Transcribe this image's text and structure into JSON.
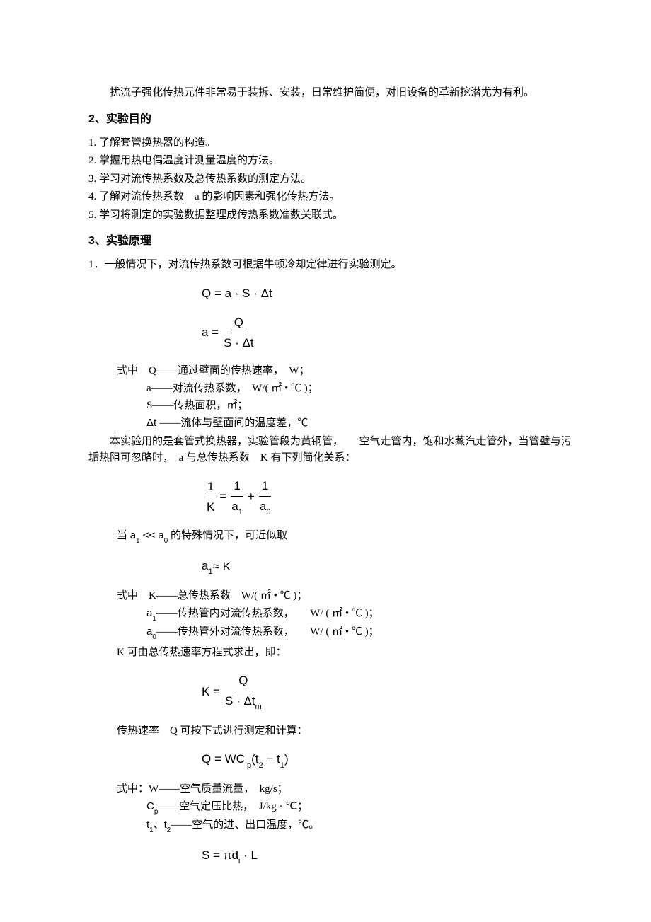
{
  "intro": "扰流子强化传热元件非常易于装拆、安装，日常维护简便，对旧设备的革新挖潜尤为有利。",
  "section2": {
    "heading_num": "2",
    "heading_text": "、实验目的",
    "items": [
      "1. 了解套管换热器的构造。",
      "2. 掌握用热电偶温度计测量温度的方法。",
      "3. 学习对流传热系数及总传热系数的测定方法。",
      "4. 了解对流传热系数　a 的影响因素和强化传热方法。",
      "5. 学习将测定的实验数据整理成传热系数准数关联式。"
    ]
  },
  "section3": {
    "heading_num": "3",
    "heading_text": "、实验原理",
    "p1": "1．一般情况下，对流传热系数可根据牛顿冷却定律进行实验测定。",
    "f1": "Q = a · S · Δt",
    "f2_lhs": "a =",
    "f2_top": "Q",
    "f2_bot": "S · Δt",
    "where_lead": "式中　Q——通过壁面的传热速率，　W；",
    "where_a": "a——对流传热系数，　W/( ㎡ • ℃ )；",
    "where_s": "S——传热面积，㎡；",
    "where_dt": "Δt ——流体与壁面间的温度差，℃",
    "p2a": "本实验用的是套管式换热器，实验管段为黄铜管，　　空气走管内，饱和水蒸汽走管外，当管壁与污垢热阻可忽略时，　a 与总传热系数　K 有下列简化关系：",
    "f3_l_top": "1",
    "f3_l_bot": "K",
    "f3_mid": " = ",
    "f3_r1_top": "1",
    "f3_r1_bot": "a",
    "f3_r1_sub": "1",
    "f3_plus": " + ",
    "f3_r2_top": "1",
    "f3_r2_bot": "a",
    "f3_r2_sub": "0",
    "p3_pre": "当 ",
    "p3_a1": "a",
    "p3_sub1": "1",
    "p3_ll": " << ",
    "p3_a0": "a",
    "p3_sub0": "0",
    "p3_post": " 的特殊情况下，可近似取",
    "f4_lhs": "a",
    "f4_sub": "1",
    "f4_approx": " ≈ K",
    "where_K": "式中　K——总传热系数　W/( ㎡ • ℃ )；",
    "where_a1_pre": "a",
    "where_a1_sub": "1",
    "where_a1_post": "——传热管内对流传热系数，　　W/ ( ㎡ • ℃ )；",
    "where_a0_pre": "a",
    "where_a0_sub": "0",
    "where_a0_post": "——传热管外对流传热系数，　　W/ ( ㎡ • ℃ )；",
    "p4": "K 可由总传热速率方程式求出，即：",
    "f5_lhs": "K =",
    "f5_top": "Q",
    "f5_bot_pre": "S · Δt",
    "f5_bot_sub": "m",
    "p5": "传热速率　Q 可按下式进行测定和计算：",
    "f6_q": "Q = WC",
    "f6_psub": " p",
    "f6_paren": "(t",
    "f6_sub2": "2",
    "f6_minus": " − t",
    "f6_sub1": "1",
    "f6_close": ")",
    "where_W": "式中：W——空气质量流量，　kg/s；",
    "where_Cp_pre": "C",
    "where_Cp_sub": "p",
    "where_Cp_post": "——空气定压比热，　J/kg · ℃；",
    "where_t_pre": "t",
    "where_t_sub1": "1",
    "where_t_comma": "、",
    "where_t_pre2": "t",
    "where_t_sub2": "2",
    "where_t_post": "——空气的进、出口温度，℃。",
    "f7_pre": "S = πd",
    "f7_sub": "i",
    "f7_post": " · L"
  }
}
